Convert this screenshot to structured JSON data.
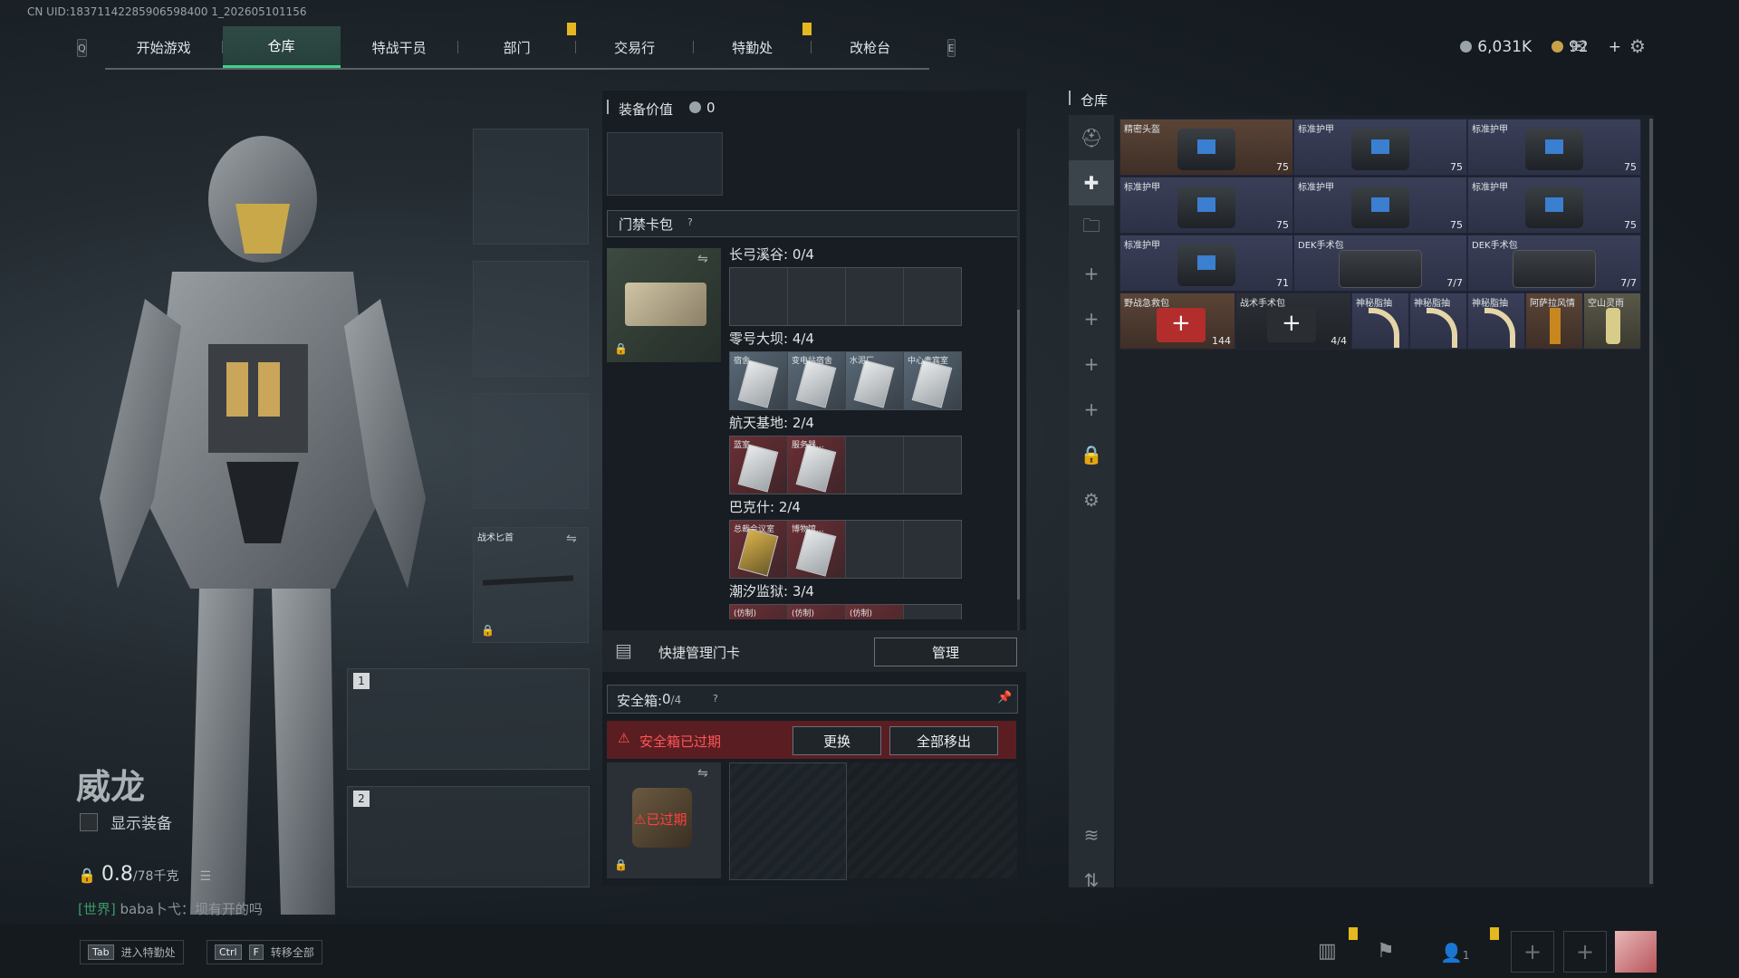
{
  "uid": "CN UID:18371142285906598400 1_202605101156",
  "nav": {
    "left_key": "Q",
    "right_key": "E",
    "tabs": [
      "开始游戏",
      "仓库",
      "特战干员",
      "部门",
      "交易行",
      "特勤处",
      "改枪台"
    ],
    "active_tab": "仓库"
  },
  "currency": {
    "silver": "6,031K",
    "gold": "92",
    "add": "+"
  },
  "icons": {
    "mail": "mail-icon",
    "settings": "gear-icon"
  },
  "operator": {
    "name": "威龙",
    "show_equipment": "显示装备",
    "weight_value": "0.8",
    "weight_max": "/78千克"
  },
  "chat": {
    "channel": "[世界]",
    "message": "baba卜弋：坝有开的吗"
  },
  "slots": {
    "melee_label": "战术匕首",
    "weapon1": "1",
    "weapon2": "2"
  },
  "middle": {
    "equip_value_label": "装备价值",
    "equip_value": "0",
    "keycard_title": "门禁卡包",
    "help": "?",
    "maps": [
      {
        "name": "长弓溪谷: 0/4",
        "cards": [
          "",
          "",
          "",
          ""
        ]
      },
      {
        "name": "零号大坝: 4/4",
        "cards": [
          "宿舍...",
          "变电站宿舍",
          "水泥厂",
          "中心贵宾室"
        ]
      },
      {
        "name": "航天基地: 2/4",
        "cards": [
          "蓝室...",
          "服务器...",
          "",
          ""
        ]
      },
      {
        "name": "巴克什: 2/4",
        "cards": [
          "总裁会议室",
          "博物馆...",
          "",
          ""
        ]
      },
      {
        "name": "潮汐监狱: 3/4",
        "cards": [
          "(仿制)",
          "(仿制)",
          "(仿制)",
          ""
        ]
      }
    ],
    "quick_manage": "快捷管理门卡",
    "manage_btn": "管理",
    "safebox_label": "安全箱:",
    "safebox_value": "0",
    "safebox_max": "/4",
    "expired_warning": "安全箱已过期",
    "replace_btn": "更换",
    "remove_all_btn": "全部移出",
    "expired_badge": "已过期"
  },
  "warehouse": {
    "title": "仓库",
    "items": [
      {
        "name": "精密头盔",
        "value": "75"
      },
      {
        "name": "标准护甲",
        "value": "75"
      },
      {
        "name": "标准护甲",
        "value": "75"
      },
      {
        "name": "标准护甲",
        "value": "75"
      },
      {
        "name": "标准护甲",
        "value": "75"
      },
      {
        "name": "标准护甲",
        "value": "75"
      },
      {
        "name": "标准护甲",
        "value": "71"
      },
      {
        "name": "DEK手术包",
        "value": "7/7"
      },
      {
        "name": "DEK手术包",
        "value": "7/7"
      },
      {
        "name": "野战急救包",
        "value": "144"
      },
      {
        "name": "战术手术包",
        "value": "4/4"
      },
      {
        "name": "神秘脂抽",
        "value": ""
      },
      {
        "name": "神秘脂抽",
        "value": ""
      },
      {
        "name": "神秘脂抽",
        "value": ""
      },
      {
        "name": "阿萨拉风情",
        "value": ""
      },
      {
        "name": "空山灵雨",
        "value": ""
      }
    ]
  },
  "bottom": {
    "hint1_key": "Tab",
    "hint1": "进入特勤处",
    "hint2_key1": "Ctrl",
    "hint2_key2": "F",
    "hint2": "转移全部",
    "team_count": "1"
  }
}
